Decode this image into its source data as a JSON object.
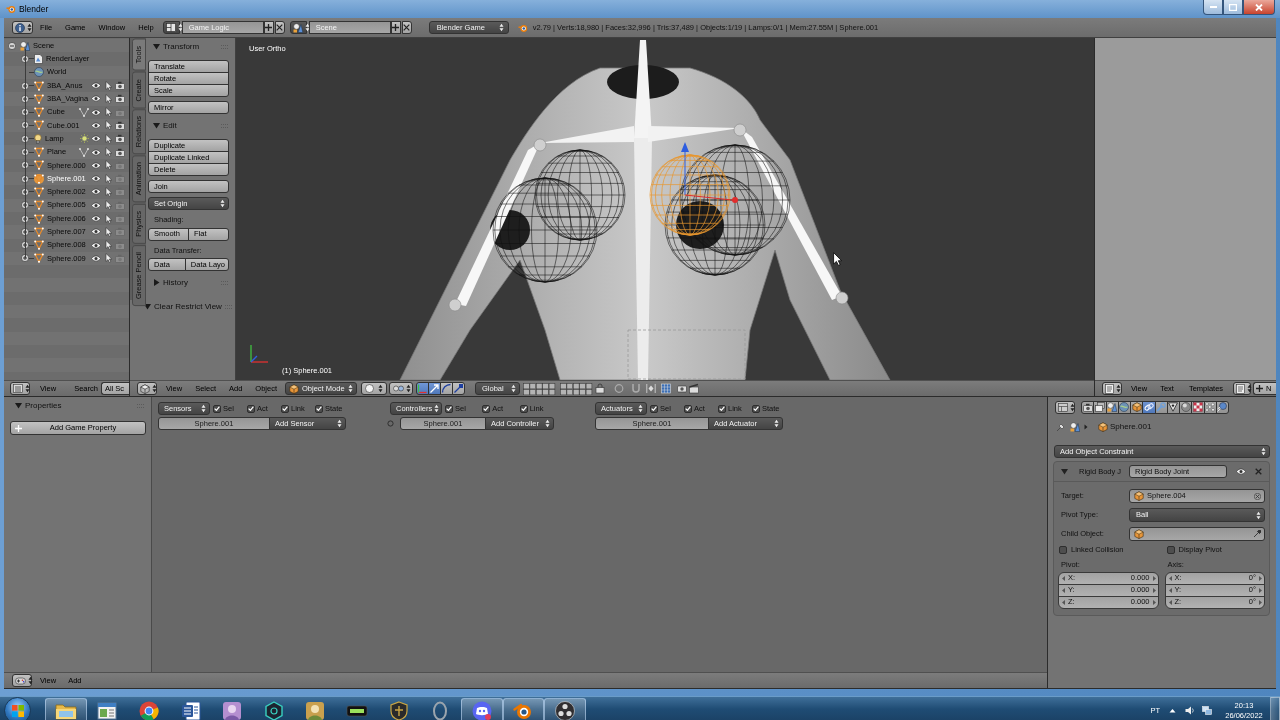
{
  "window": {
    "title": "Blender"
  },
  "info_header": {
    "menus": [
      "File",
      "Game",
      "Window",
      "Help"
    ],
    "screen_layout": "Game Logic",
    "scene": "Scene",
    "engine": "Blender Game",
    "stats": "v2.79 | Verts:18,980 | Faces:32,996 | Tris:37,489 | Objects:1/19 | Lamps:0/1 | Mem:27.55M | Sphere.001"
  },
  "outliner": {
    "tree": [
      {
        "label": "Scene",
        "kind": "scene",
        "expanded": true,
        "selected": false,
        "children": [
          {
            "label": "RenderLayer",
            "kind": "render_layer",
            "expanded": false,
            "selected": false
          },
          {
            "label": "World",
            "kind": "world",
            "selected": false
          },
          {
            "label": "3BA_Anus",
            "kind": "mesh",
            "expanded": false,
            "selected": false,
            "renderable": true
          },
          {
            "label": "3BA_Vagina",
            "kind": "mesh",
            "expanded": false,
            "selected": false,
            "renderable": true
          },
          {
            "label": "Cube",
            "kind": "mesh",
            "expanded": false,
            "selected": false,
            "renderable": false,
            "data": {
              "kind": "vertices"
            }
          },
          {
            "label": "Cube.001",
            "kind": "mesh",
            "expanded": false,
            "selected": false,
            "renderable": true
          },
          {
            "label": "Lamp",
            "kind": "lamp",
            "expanded": false,
            "selected": false,
            "renderable": true,
            "data": {
              "kind": "light"
            }
          },
          {
            "label": "Plane",
            "kind": "mesh",
            "expanded": false,
            "selected": false,
            "renderable": true,
            "data": {
              "kind": "vertices"
            }
          },
          {
            "label": "Sphere.000",
            "kind": "mesh",
            "expanded": false,
            "selected": false,
            "renderable": false
          },
          {
            "label": "Sphere.001",
            "kind": "mesh",
            "expanded": false,
            "selected": true,
            "renderable": false
          },
          {
            "label": "Sphere.002",
            "kind": "mesh",
            "expanded": false,
            "selected": false,
            "renderable": false
          },
          {
            "label": "Sphere.005",
            "kind": "mesh",
            "expanded": false,
            "selected": false,
            "renderable": false
          },
          {
            "label": "Sphere.006",
            "kind": "mesh",
            "expanded": false,
            "selected": false,
            "renderable": false
          },
          {
            "label": "Sphere.007",
            "kind": "mesh",
            "expanded": false,
            "selected": false,
            "renderable": false
          },
          {
            "label": "Sphere.008",
            "kind": "mesh",
            "expanded": false,
            "selected": false,
            "renderable": false
          },
          {
            "label": "Sphere.009",
            "kind": "mesh",
            "expanded": false,
            "selected": false,
            "renderable": false
          }
        ]
      }
    ],
    "header": {
      "menus": [
        "View",
        "Search"
      ],
      "display_mode": "All Sc"
    }
  },
  "tool_shelf": {
    "tabs": [
      {
        "label": "Tools",
        "selected": true
      },
      {
        "label": "Create",
        "selected": false
      },
      {
        "label": "Relations",
        "selected": false
      },
      {
        "label": "Animation",
        "selected": false
      },
      {
        "label": "Physics",
        "selected": false
      },
      {
        "label": "Grease Pencil",
        "selected": false
      }
    ],
    "panels": [
      {
        "title": "Transform",
        "expanded": true,
        "items": [
          {
            "kind": "stack",
            "buttons": [
              "Translate",
              "Rotate",
              "Scale"
            ]
          },
          {
            "kind": "button",
            "label": "Mirror"
          }
        ]
      },
      {
        "title": "Edit",
        "expanded": true,
        "items": [
          {
            "kind": "stack",
            "buttons": [
              "Duplicate",
              "Duplicate Linked",
              "Delete"
            ]
          },
          {
            "kind": "button",
            "label": "Join"
          },
          {
            "kind": "menu",
            "label": "Set Origin"
          },
          {
            "kind": "label",
            "label": "Shading:"
          },
          {
            "kind": "row",
            "buttons": [
              "Smooth",
              "Flat"
            ]
          },
          {
            "kind": "label",
            "label": "Data Transfer:"
          },
          {
            "kind": "row",
            "buttons": [
              "Data",
              "Data Layo"
            ]
          }
        ]
      },
      {
        "title": "History",
        "expanded": false
      },
      {
        "title": "Clear Restrict View",
        "expanded": true
      }
    ]
  },
  "viewport": {
    "view_name": "User Ortho",
    "object_label": "(1) Sphere.001",
    "header": {
      "menus": [
        "View",
        "Select",
        "Add",
        "Object"
      ],
      "mode": "Object Mode",
      "orientation": "Global",
      "manipulators": [
        {
          "kind": "toggle",
          "on": true
        },
        {
          "kind": "translate",
          "on": true
        },
        {
          "kind": "rotate",
          "on": false
        },
        {
          "kind": "scale",
          "on": false
        }
      ]
    }
  },
  "text_editor": {
    "header": {
      "menus": [
        "View",
        "Text",
        "Templates"
      ],
      "new_button": "N"
    }
  },
  "logic_editor": {
    "properties": {
      "title": "Properties",
      "expanded": true,
      "add_button": "Add Game Property"
    },
    "columns": [
      {
        "kind": "sensors",
        "type_menu": "Sensors",
        "filters": [
          {
            "label": "Sel",
            "checked": true
          },
          {
            "label": "Act",
            "checked": true
          },
          {
            "label": "Link",
            "checked": true
          },
          {
            "label": "State",
            "checked": true
          }
        ],
        "object": "Sphere.001",
        "add_menu": "Add Sensor"
      },
      {
        "kind": "controllers",
        "type_menu": "Controllers",
        "filters": [
          {
            "label": "Sel",
            "checked": true
          },
          {
            "label": "Act",
            "checked": true
          },
          {
            "label": "Link",
            "checked": true
          }
        ],
        "object": "Sphere.001",
        "add_menu": "Add Controller"
      },
      {
        "kind": "actuators",
        "type_menu": "Actuators",
        "filters": [
          {
            "label": "Sel",
            "checked": true
          },
          {
            "label": "Act",
            "checked": true
          },
          {
            "label": "Link",
            "checked": true
          },
          {
            "label": "State",
            "checked": true
          }
        ],
        "object": "Sphere.001",
        "add_menu": "Add Actuator"
      }
    ],
    "footer": {
      "menus": [
        "View",
        "Add"
      ]
    }
  },
  "properties": {
    "tabs": [
      {
        "kind": "render",
        "selected": false
      },
      {
        "kind": "render_layers",
        "selected": false
      },
      {
        "kind": "scene",
        "selected": false
      },
      {
        "kind": "world",
        "selected": false
      },
      {
        "kind": "object",
        "selected": false
      },
      {
        "kind": "constraints",
        "selected": true
      },
      {
        "kind": "modifiers",
        "selected": false
      },
      {
        "kind": "data",
        "selected": false
      },
      {
        "kind": "material",
        "selected": false
      },
      {
        "kind": "texture",
        "selected": false
      },
      {
        "kind": "particles",
        "selected": false
      },
      {
        "kind": "physics",
        "selected": false
      }
    ],
    "context": "Sphere.001",
    "add_constraint": "Add Object Constraint",
    "constraint": {
      "type_label": "Rigid Body J",
      "name": "Rigid Body Joint",
      "expanded": true,
      "fields": [
        {
          "label": "Target:",
          "kind": "object",
          "value": "Sphere.004"
        },
        {
          "label": "Pivot Type:",
          "kind": "enum",
          "value": "Ball"
        },
        {
          "label": "Child Object:",
          "kind": "object_picker"
        }
      ],
      "checkboxes": [
        {
          "label": "Linked Collision",
          "checked": false
        },
        {
          "label": "Display Pivot",
          "checked": false
        }
      ],
      "vectors": [
        {
          "label": "Pivot:",
          "components": [
            {
              "axis": "X:",
              "value": "0.000"
            },
            {
              "axis": "Y:",
              "value": "0.000"
            },
            {
              "axis": "Z:",
              "value": "0.000"
            }
          ]
        },
        {
          "label": "Axis:",
          "components": [
            {
              "axis": "X:",
              "value": "0°"
            },
            {
              "axis": "Y:",
              "value": "0°"
            },
            {
              "axis": "Z:",
              "value": "0°"
            }
          ]
        }
      ]
    }
  },
  "taskbar": {
    "apps": [
      {
        "kind": "folder",
        "running": true
      },
      {
        "kind": "window",
        "running": false
      },
      {
        "kind": "browser",
        "running": false
      },
      {
        "kind": "document",
        "running": false
      },
      {
        "kind": "portrait",
        "running": false
      },
      {
        "kind": "hexagon",
        "running": false
      },
      {
        "kind": "character",
        "running": false
      },
      {
        "kind": "bar",
        "running": false
      },
      {
        "kind": "shield",
        "running": false
      },
      {
        "kind": "ring",
        "running": false
      },
      {
        "kind": "chat",
        "running": true
      },
      {
        "kind": "blender",
        "running": true
      },
      {
        "kind": "recorder",
        "running": true
      }
    ],
    "tray": {
      "language": "PT",
      "time": "20:13",
      "date": "26/06/2022"
    }
  }
}
